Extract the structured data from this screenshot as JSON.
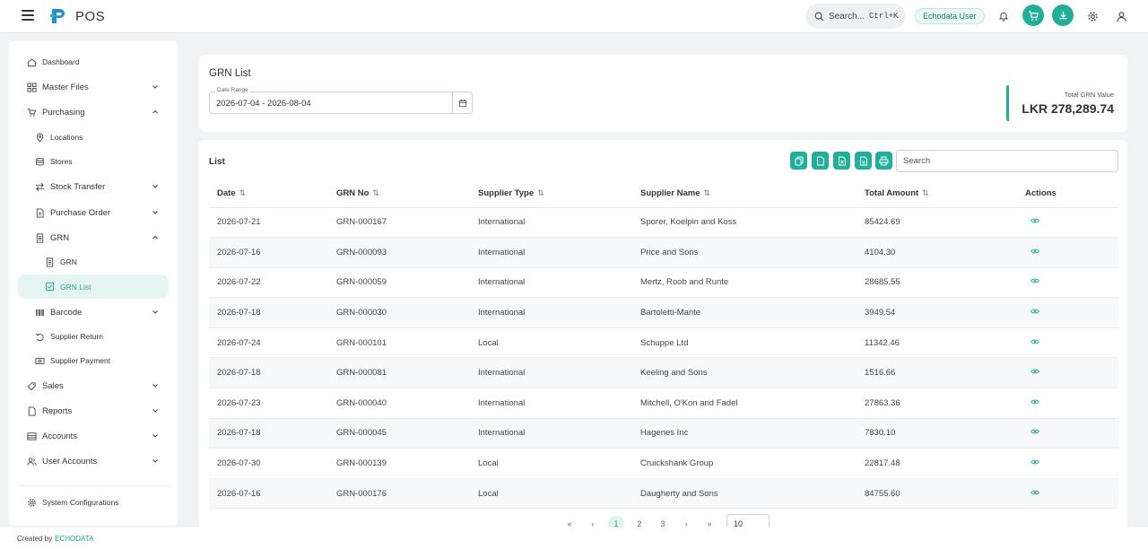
{
  "app": {
    "title": "POS",
    "search_label": "Search...",
    "search_shortcut": "Ctrl+K",
    "user_badge": "Echodata User",
    "accent": "#20b09a"
  },
  "sidebar": {
    "items": [
      {
        "label": "Dashboard",
        "icon": "home-icon"
      },
      {
        "label": "Master Files",
        "icon": "grid-icon"
      },
      {
        "label": "Purchasing",
        "icon": "cart-icon"
      },
      {
        "label": "Locations",
        "icon": "location-icon"
      },
      {
        "label": "Stores",
        "icon": "store-icon"
      },
      {
        "label": "Stock Transfer",
        "icon": "transfer-icon"
      },
      {
        "label": "Purchase Order",
        "icon": "document-icon"
      },
      {
        "label": "GRN",
        "icon": "clipboard-icon"
      },
      {
        "label": "GRN",
        "icon": "clipboard-icon"
      },
      {
        "label": "GRN List",
        "icon": "checklist-icon"
      },
      {
        "label": "Barcode",
        "icon": "barcode-icon"
      },
      {
        "label": "Supplier Return",
        "icon": "return-icon"
      },
      {
        "label": "Supplier Payment",
        "icon": "payment-icon"
      },
      {
        "label": "Sales",
        "icon": "sales-icon"
      },
      {
        "label": "Reports",
        "icon": "report-icon"
      },
      {
        "label": "Accounts",
        "icon": "accounts-icon"
      },
      {
        "label": "User Accounts",
        "icon": "users-icon"
      }
    ],
    "system_config": "System Configurations"
  },
  "grn": {
    "title": "GRN List",
    "date_range_label": "Date Range",
    "date_range_value": "2026-07-04 - 2026-08-04",
    "total_label": "Total GRN Value",
    "total_value": "LKR 278,289.74"
  },
  "list": {
    "title": "List",
    "search_placeholder": "Search",
    "columns": [
      "Date",
      "GRN No",
      "Supplier Type",
      "Supplier Name",
      "Total Amount",
      "Actions"
    ],
    "rows": [
      {
        "date": "2026-07-21",
        "grn": "GRN-000167",
        "type": "International",
        "supplier": "Sporer, Koelpin and Koss",
        "amount": "85424.69"
      },
      {
        "date": "2026-07-16",
        "grn": "GRN-000093",
        "type": "International",
        "supplier": "Price and Sons",
        "amount": "4104.30"
      },
      {
        "date": "2026-07-22",
        "grn": "GRN-000059",
        "type": "International",
        "supplier": "Mertz, Roob and Runte",
        "amount": "28685.55"
      },
      {
        "date": "2026-07-18",
        "grn": "GRN-000030",
        "type": "International",
        "supplier": "Bartoletti-Mante",
        "amount": "3949.54"
      },
      {
        "date": "2026-07-24",
        "grn": "GRN-000101",
        "type": "Local",
        "supplier": "Schuppe Ltd",
        "amount": "11342.46"
      },
      {
        "date": "2026-07-18",
        "grn": "GRN-000081",
        "type": "International",
        "supplier": "Keeling and Sons",
        "amount": "1516.66"
      },
      {
        "date": "2026-07-23",
        "grn": "GRN-000040",
        "type": "International",
        "supplier": "Mitchell, O'Kon and Fadel",
        "amount": "27863.36"
      },
      {
        "date": "2026-07-18",
        "grn": "GRN-000045",
        "type": "International",
        "supplier": "Hagenes Inc",
        "amount": "7830.10"
      },
      {
        "date": "2026-07-30",
        "grn": "GRN-000139",
        "type": "Local",
        "supplier": "Cruickshank Group",
        "amount": "22817.48"
      },
      {
        "date": "2026-07-16",
        "grn": "GRN-000176",
        "type": "Local",
        "supplier": "Daugherty and Sons",
        "amount": "84755.60"
      }
    ]
  },
  "pagination": {
    "first": "«",
    "prev": "‹",
    "pages": [
      "1",
      "2",
      "3"
    ],
    "next": "›",
    "last": "»",
    "page_size": "10"
  },
  "footer": {
    "prefix": "Created by",
    "brand": "ECHODATA"
  }
}
